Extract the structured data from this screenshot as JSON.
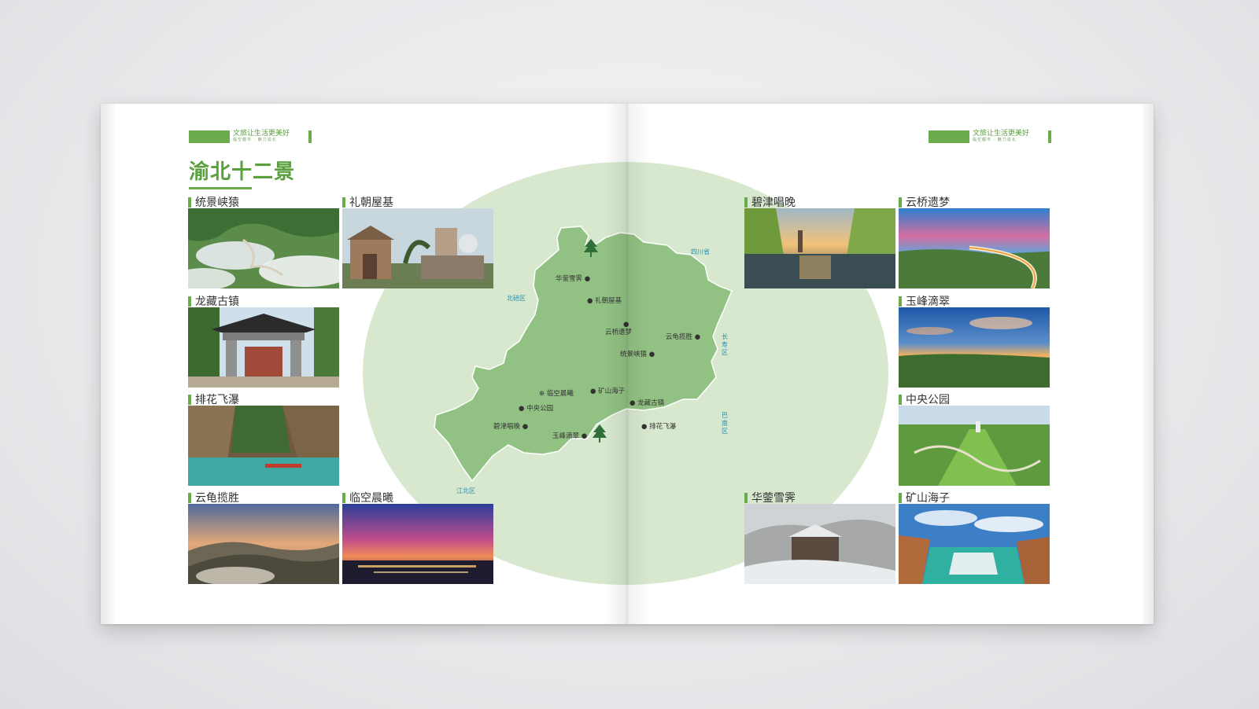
{
  "slogan": {
    "line1": "文旅让生活更美好",
    "line2": "临空都市 · 魅力渝北"
  },
  "title": "渝北十二景",
  "spots_left": [
    {
      "name": "统景峡猿",
      "photo": "canyon-mist"
    },
    {
      "name": "礼朝屋基",
      "photo": "stone-house"
    },
    {
      "name": "龙藏古镇",
      "photo": "archway"
    },
    {
      "name": "排花飞瀑",
      "photo": "gorge-river"
    },
    {
      "name": "云龟揽胜",
      "photo": "mountain-sunset"
    },
    {
      "name": "临空晨曦",
      "photo": "city-dawn"
    }
  ],
  "spots_right": [
    {
      "name": "碧津唱晚",
      "photo": "lake-pagoda"
    },
    {
      "name": "云桥遗梦",
      "photo": "bridge-night"
    },
    {
      "name": "玉峰滴翠",
      "photo": "sunset-valley"
    },
    {
      "name": "中央公园",
      "photo": "park-aerial"
    },
    {
      "name": "华蓥雪霁",
      "photo": "snow-temple"
    },
    {
      "name": "矿山海子",
      "photo": "quarry-lake"
    }
  ],
  "map": {
    "points": [
      {
        "name": "华蓥雪霁"
      },
      {
        "name": "礼朝屋基"
      },
      {
        "name": "云桥遗梦"
      },
      {
        "name": "云龟揽胜"
      },
      {
        "name": "统景峡猿"
      },
      {
        "name": "临空晨曦"
      },
      {
        "name": "矿山海子"
      },
      {
        "name": "中央公园"
      },
      {
        "name": "龙藏古镇"
      },
      {
        "name": "碧津唱晚"
      },
      {
        "name": "玉峰滴翠"
      },
      {
        "name": "排花飞瀑"
      }
    ],
    "regions": {
      "sichuan": "四川省",
      "beibei": "北碚区",
      "changshou": "长寿区",
      "banan": "巴南区",
      "jiangbei": "江北区"
    }
  },
  "colors": {
    "accent": "#6aac4c",
    "circle": "#d7e8cf",
    "map_fill": "#92c283",
    "region_text": "#2a8fb0"
  }
}
